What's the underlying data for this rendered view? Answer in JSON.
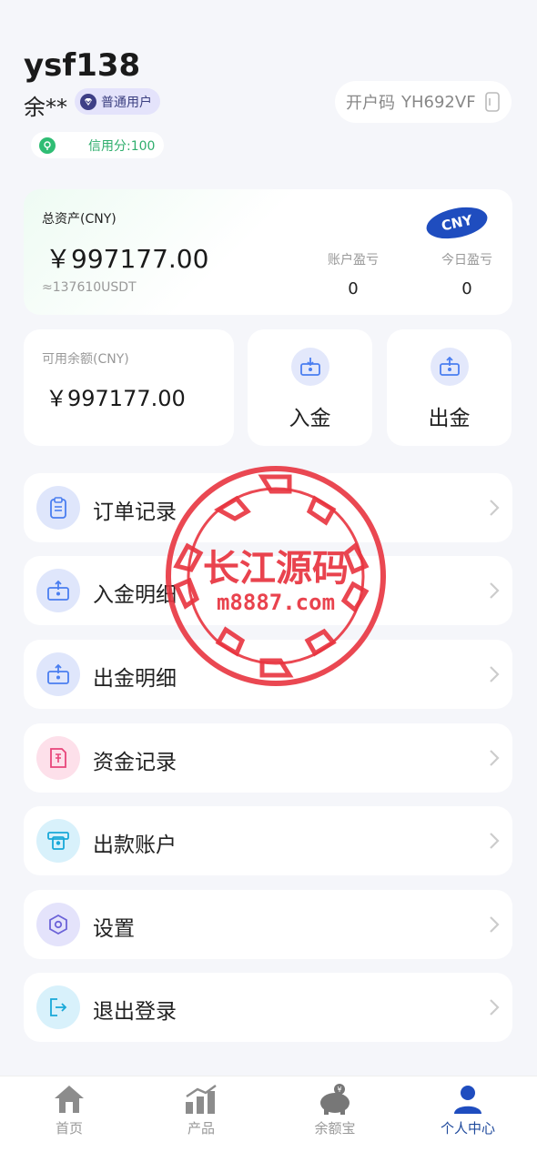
{
  "user": {
    "username": "ysf138",
    "real_name": "余**",
    "level_badge": "普通用户",
    "invite_label": "开户码",
    "invite_code": "YH692VF",
    "credit": "信用分:100"
  },
  "assets": {
    "label": "总资产(CNY)",
    "amount": "￥997177.00",
    "usdt": "≈137610USDT",
    "currency_tag": "CNY",
    "account_pnl_label": "账户盈亏",
    "account_pnl_value": "0",
    "today_pnl_label": "今日盈亏",
    "today_pnl_value": "0"
  },
  "balance": {
    "label": "可用余额(CNY)",
    "amount": "￥997177.00"
  },
  "actions": {
    "deposit": "入金",
    "withdraw": "出金"
  },
  "menu": [
    {
      "label": "订单记录",
      "icon": "clipboard-icon"
    },
    {
      "label": "入金明细",
      "icon": "deposit-icon"
    },
    {
      "label": "出金明细",
      "icon": "withdraw-icon"
    },
    {
      "label": "资金记录",
      "icon": "fund-record-icon"
    },
    {
      "label": "出款账户",
      "icon": "atm-icon"
    },
    {
      "label": "设置",
      "icon": "settings-icon"
    },
    {
      "label": "退出登录",
      "icon": "logout-icon"
    }
  ],
  "watermark": {
    "title": "长江源码",
    "url": "m8887.com"
  },
  "nav": [
    {
      "label": "首页",
      "icon": "home-icon"
    },
    {
      "label": "产品",
      "icon": "chart-bar-icon"
    },
    {
      "label": "余额宝",
      "icon": "piggy-bank-icon"
    },
    {
      "label": "个人中心",
      "icon": "user-icon"
    }
  ],
  "colors": {
    "accent": "#1f4dbf",
    "nav_active": "#1f4a9c",
    "credit_green": "#2fae6d",
    "stamp_red": "#e8343f"
  }
}
